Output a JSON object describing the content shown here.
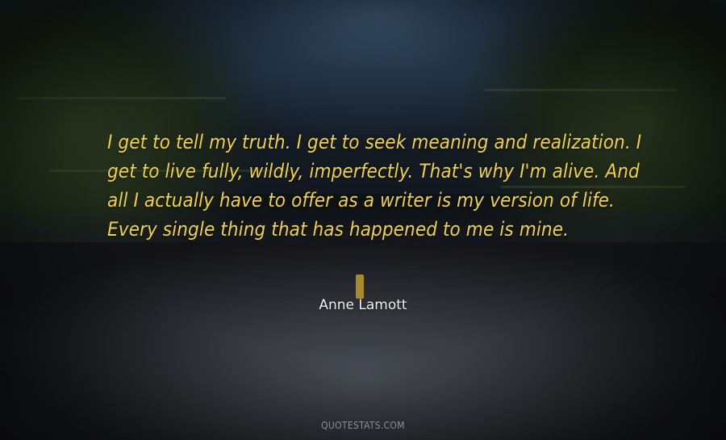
{
  "quote": {
    "text": "I get to tell my truth. I get to seek meaning and realization. I get to live fully, wildly, imperfectly. That's why I'm alive. And all I actually have to offer as a writer is my version of life. Every single thing that has happened to me is mine.",
    "author": "Anne Lamott"
  },
  "watermark": "QUOTESTATS.COM",
  "colors": {
    "quote_text": "#f2d23c",
    "author_text": "#f0f0f0",
    "watermark_text": "#8a8d92"
  }
}
